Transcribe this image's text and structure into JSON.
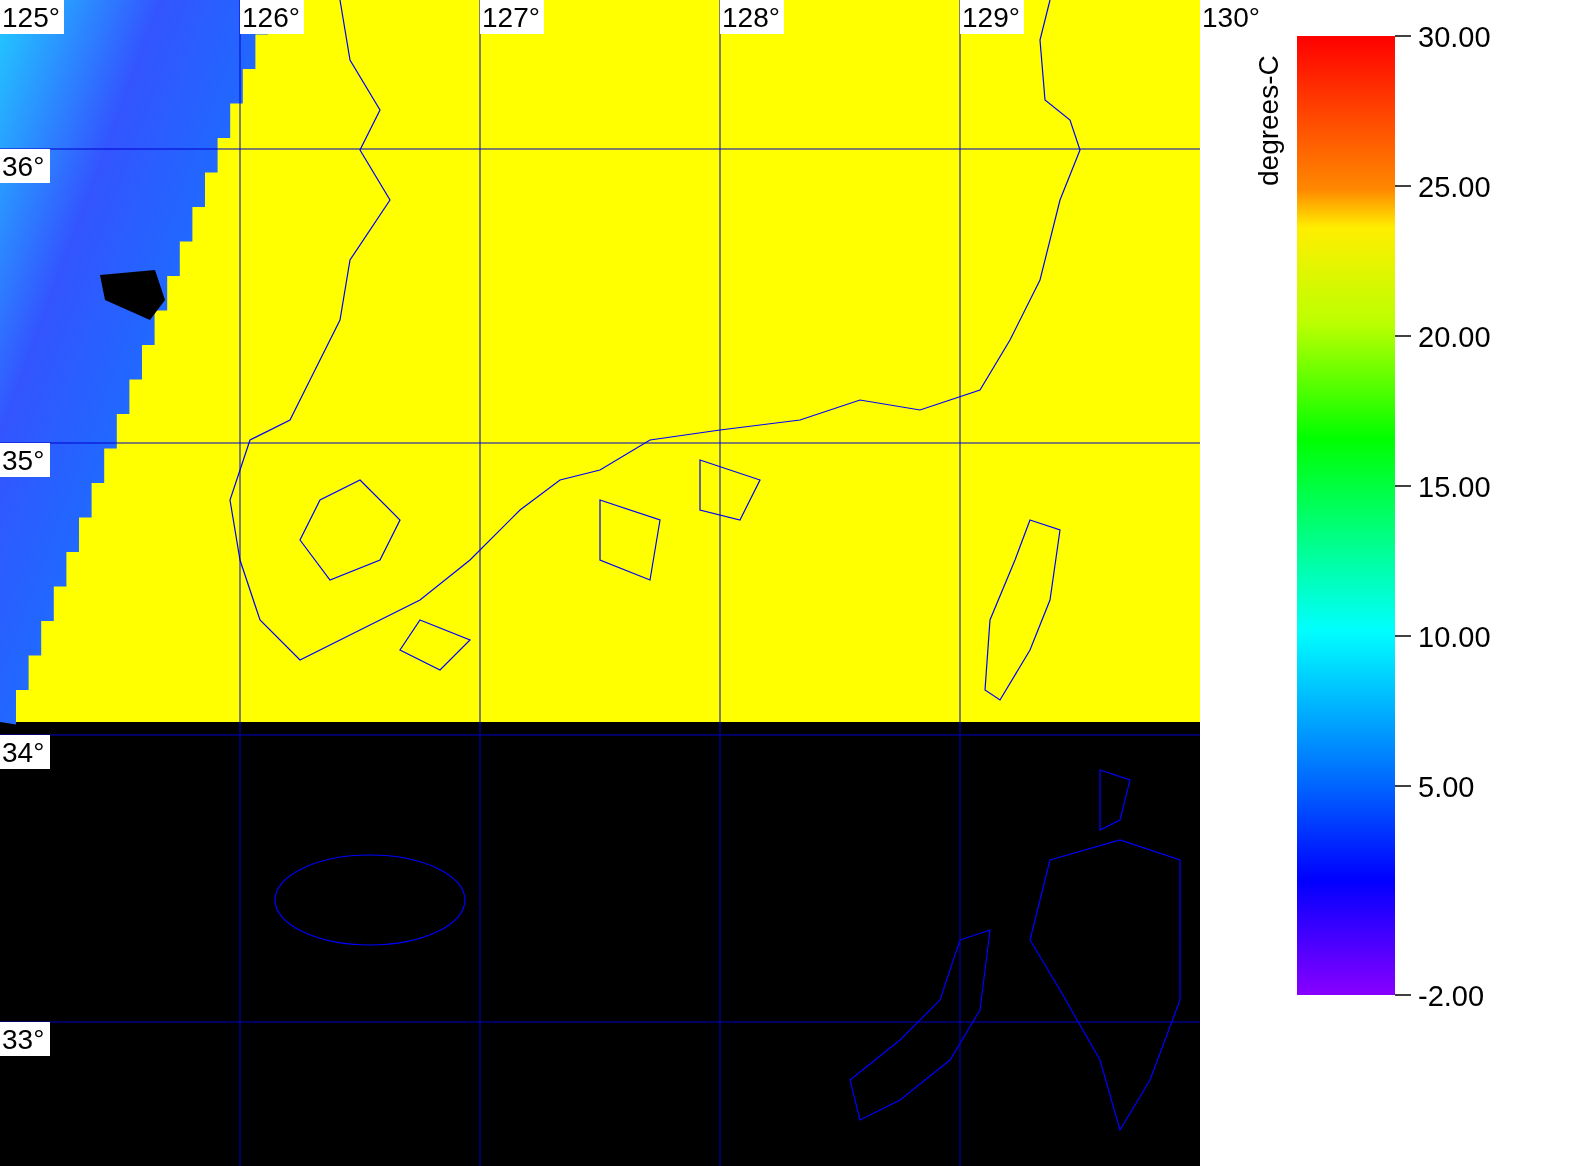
{
  "map": {
    "longitude_labels": [
      "125°",
      "126°",
      "127°",
      "128°",
      "129°",
      "130°"
    ],
    "latitude_labels": [
      "36°",
      "35°",
      "34°",
      "33°"
    ]
  },
  "colorbar": {
    "unit": "degrees-C",
    "tick_labels": [
      "30.00",
      "25.00",
      "20.00",
      "15.00",
      "10.00",
      "5.00",
      "-2.00"
    ]
  }
}
